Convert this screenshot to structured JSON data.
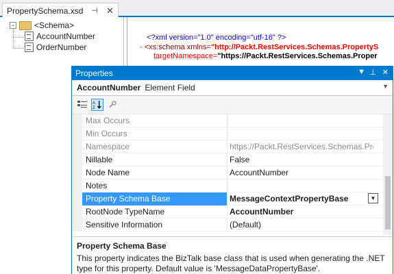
{
  "editor_tab": {
    "title": "PropertySchema.xsd",
    "pin_icon": "pin-icon",
    "close_icon": "close-icon"
  },
  "tree": {
    "root": {
      "label": "<Schema>",
      "expander": "−"
    },
    "children": [
      {
        "label": "AccountNumber"
      },
      {
        "label": "OrderNumber"
      }
    ]
  },
  "xml": {
    "line1": "<?xml version=\"1.0\" encoding=\"utf-16\" ?>",
    "line2_prefix": "-",
    "line2_tag": "<xs:schema xmlns=",
    "line2_value": "\"http://Packt.RestServices.Schemas.PropertyS",
    "line3_attr": "targetNamespace=",
    "line3_value": "\"https://Packt.RestServices.Schemas.Proper"
  },
  "properties_window": {
    "title": "Properties",
    "object_name": "AccountNumber",
    "object_type": "Element Field",
    "toolbar": {
      "categorized_icon": "categorized-icon",
      "alphabetical_icon": "alphabetical-icon",
      "property_pages_icon": "wrench-icon"
    },
    "rows": [
      {
        "name": "Max Occurs",
        "value": ""
      },
      {
        "name": "Min Occurs",
        "value": ""
      },
      {
        "name": "Namespace",
        "value": "https://Packt.RestServices.Schemas.Prope"
      },
      {
        "name": "Nillable",
        "value": "False"
      },
      {
        "name": "Node Name",
        "value": "AccountNumber"
      },
      {
        "name": "Notes",
        "value": ""
      },
      {
        "name": "Property Schema Base",
        "value": "MessageContextPropertyBase"
      },
      {
        "name": "RootNode TypeName",
        "value": "AccountNumber"
      },
      {
        "name": "Sensitive Information",
        "value": "(Default)"
      }
    ],
    "description": {
      "title": "Property Schema Base",
      "text": "This property indicates the BizTalk base class that is used when generating the .NET type for this property. Default value is 'MessageDataPropertyBase'."
    }
  },
  "colors": {
    "accent": "#007acc",
    "selection": "#3399ff"
  }
}
